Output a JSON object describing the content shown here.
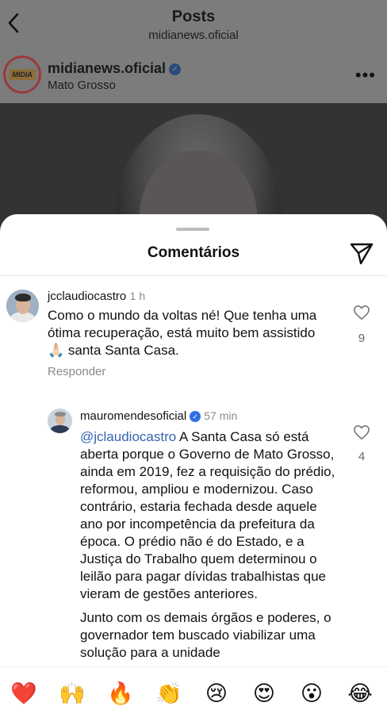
{
  "header": {
    "title": "Posts",
    "subtitle": "midianews.oficial"
  },
  "post": {
    "account_name": "midianews.oficial",
    "location": "Mato Grosso",
    "logo_text": "MIDIA",
    "more_label": "•••"
  },
  "comments_sheet": {
    "title": "Comentários",
    "comments": [
      {
        "username": "jcclaudiocastro",
        "time": "1 h",
        "text": "Como o mundo da voltas né! Que tenha uma ótima recuperação, está  muito bem assistido🙏🏻 santa Santa Casa.",
        "reply_label": "Responder",
        "likes": "9"
      },
      {
        "username": "mauromendesoficial",
        "time": "57 min",
        "mention": "@jclaudiocastro",
        "text_p1": " A Santa Casa só está aberta porque o Governo de Mato Grosso, ainda em 2019, fez a requisição do prédio, reformou, ampliou e modernizou. Caso contrário, estaria fechada desde aquele ano por incompetência da prefeitura da época. O prédio não é do Estado, e a Justiça do Trabalho quem determinou o leilão para pagar dívidas trabalhistas que vieram de gestões anteriores.",
        "text_p2": "Junto com os demais órgãos e poderes, o governador tem buscado viabilizar uma solução para a unidade",
        "likes": "4"
      }
    ]
  },
  "emoji_bar": [
    "❤️",
    "🙌",
    "🔥",
    "👏",
    "😢",
    "😍",
    "😮",
    "😂"
  ],
  "colors": {
    "mention": "#3563b0",
    "verified": "#2f6fe4"
  }
}
